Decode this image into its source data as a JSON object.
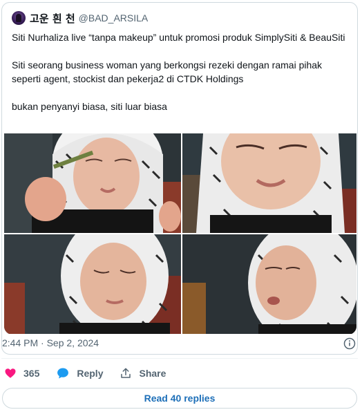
{
  "author": {
    "display_name": "고운 흰 천",
    "handle": "@BAD_ARSILA"
  },
  "tweet": {
    "paragraphs": [
      "Siti Nurhaliza live “tanpa makeup” untuk promosi produk SimplySiti & BeauSiti",
      "Siti seorang business woman yang berkongsi rezeki dengan ramai pihak seperti agent, stockist dan pekerja2 di CTDK Holdings",
      "bukan penyanyi biasa, siti luar biasa"
    ],
    "timestamp": "2:44 PM · Sep 2, 2024"
  },
  "media": {
    "photos": [
      {
        "icon": "photo-woman-applying-makeup"
      },
      {
        "icon": "photo-woman-smiling-closeup"
      },
      {
        "icon": "photo-woman-looking-down"
      },
      {
        "icon": "photo-woman-speaking-profile"
      }
    ]
  },
  "actions": {
    "like_count": "365",
    "reply_label": "Reply",
    "share_label": "Share"
  },
  "footer": {
    "read_replies_label": "Read 40 replies"
  },
  "colors": {
    "like": "#f91880",
    "reply": "#1d9bf0",
    "link": "#1d6fb8",
    "border": "#cfd9de",
    "muted": "#536471"
  }
}
